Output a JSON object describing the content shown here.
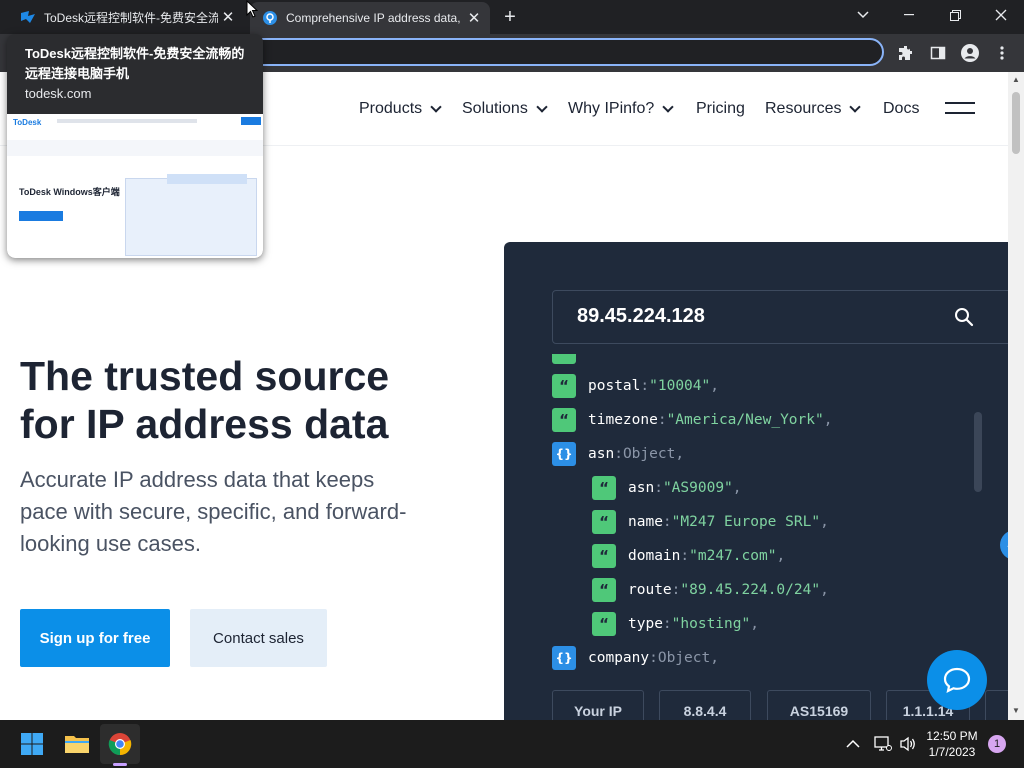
{
  "browser": {
    "tabs": [
      {
        "title": "ToDesk远程控制软件-免费安全流",
        "favicon": "todesk-icon"
      },
      {
        "title": "Comprehensive IP address data, I",
        "favicon": "ipinfo-icon"
      }
    ],
    "accent": "#8ab4f8"
  },
  "hovercard": {
    "title": "ToDesk远程控制软件-免费安全流畅的远程连接电脑手机",
    "url": "todesk.com",
    "preview": {
      "logo": "ToDesk",
      "heading": "ToDesk Windows客户端"
    }
  },
  "nav": {
    "items": [
      {
        "label": "Products",
        "has_menu": true
      },
      {
        "label": "Solutions",
        "has_menu": true
      },
      {
        "label": "Why IPinfo?",
        "has_menu": true
      },
      {
        "label": "Pricing",
        "has_menu": false
      },
      {
        "label": "Resources",
        "has_menu": true
      },
      {
        "label": "Docs",
        "has_menu": false
      }
    ]
  },
  "hero": {
    "title": "The trusted source for IP address data",
    "subtitle": "Accurate IP address data that keeps pace with secure, specific, and forward-looking use cases.",
    "primary_cta": "Sign up for free",
    "secondary_cta": "Contact sales",
    "primary_color": "#0b8fe8"
  },
  "panel": {
    "ip": "89.45.224.128",
    "lines": [
      {
        "type": "str",
        "key": "postal",
        "value": "\"10004\"",
        "indent": 0
      },
      {
        "type": "str",
        "key": "timezone",
        "value": "\"America/New_York\"",
        "indent": 0
      },
      {
        "type": "obj",
        "key": "asn",
        "value": "Object",
        "indent": 0
      },
      {
        "type": "str",
        "key": "asn",
        "value": "\"AS9009\"",
        "indent": 1
      },
      {
        "type": "str",
        "key": "name",
        "value": "\"M247 Europe SRL\"",
        "indent": 1
      },
      {
        "type": "str",
        "key": "domain",
        "value": "\"m247.com\"",
        "indent": 1
      },
      {
        "type": "str",
        "key": "route",
        "value": "\"89.45.224.0/24\"",
        "indent": 1
      },
      {
        "type": "str",
        "key": "type",
        "value": "\"hosting\"",
        "indent": 1
      },
      {
        "type": "obj",
        "key": "company",
        "value": "Object",
        "indent": 0
      }
    ],
    "chips": [
      "Your IP",
      "8.8.4.4",
      "AS15169",
      "1.1.1.14"
    ],
    "bg_color": "#1f2a3b"
  },
  "taskbar": {
    "time": "12:50 PM",
    "date": "1/7/2023",
    "notification_count": "1"
  }
}
